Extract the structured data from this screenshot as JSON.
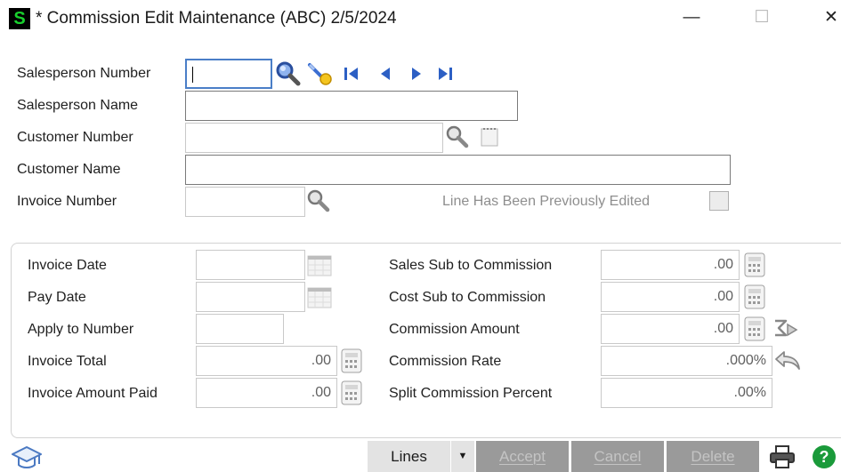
{
  "window": {
    "app_icon_letter": "S",
    "title": "* Commission Edit Maintenance (ABC) 2/5/2024",
    "minimize": "—",
    "maximize": "☐",
    "close": "✕"
  },
  "header_fields": {
    "salesperson_number": {
      "label": "Salesperson Number",
      "value": ""
    },
    "salesperson_name": {
      "label": "Salesperson Name",
      "value": ""
    },
    "customer_number": {
      "label": "Customer Number",
      "value": ""
    },
    "customer_name": {
      "label": "Customer Name",
      "value": ""
    },
    "invoice_number": {
      "label": "Invoice Number",
      "value": ""
    },
    "line_edited": {
      "label": "Line Has Been Previously Edited",
      "checked": false
    }
  },
  "detail_fields": {
    "invoice_date": {
      "label": "Invoice Date",
      "value": ""
    },
    "pay_date": {
      "label": "Pay Date",
      "value": ""
    },
    "apply_to_number": {
      "label": "Apply to Number",
      "value": ""
    },
    "invoice_total": {
      "label": "Invoice Total",
      "value": ".00"
    },
    "invoice_amount_paid": {
      "label": "Invoice Amount Paid",
      "value": ".00"
    },
    "sales_sub": {
      "label": "Sales Sub to Commission",
      "value": ".00"
    },
    "cost_sub": {
      "label": "Cost Sub to Commission",
      "value": ".00"
    },
    "commission_amount": {
      "label": "Commission Amount",
      "value": ".00"
    },
    "commission_rate": {
      "label": "Commission Rate",
      "value": ".000%"
    },
    "split_commission": {
      "label": "Split Commission Percent",
      "value": ".00%"
    }
  },
  "buttons": {
    "lines": "Lines",
    "accept": "Accept",
    "cancel": "Cancel",
    "delete": "Delete"
  },
  "icons": {
    "lookup": "magnifier-icon",
    "wizard": "wand-search-icon",
    "first": "first-record-icon",
    "prev": "previous-record-icon",
    "next": "next-record-icon",
    "last": "last-record-icon",
    "calendar": "calendar-icon",
    "calculator": "calculator-icon",
    "recalc": "recalculate-icon",
    "undo": "undo-icon",
    "help_training": "graduation-cap-icon",
    "print": "printer-icon",
    "help": "help-icon"
  },
  "colors": {
    "focus_border": "#4a7ec7",
    "nav_arrow": "#2c5fc4",
    "disabled_button": "#9a9a9a",
    "help_green": "#1a9a3a",
    "app_icon_green": "#19d12e"
  }
}
